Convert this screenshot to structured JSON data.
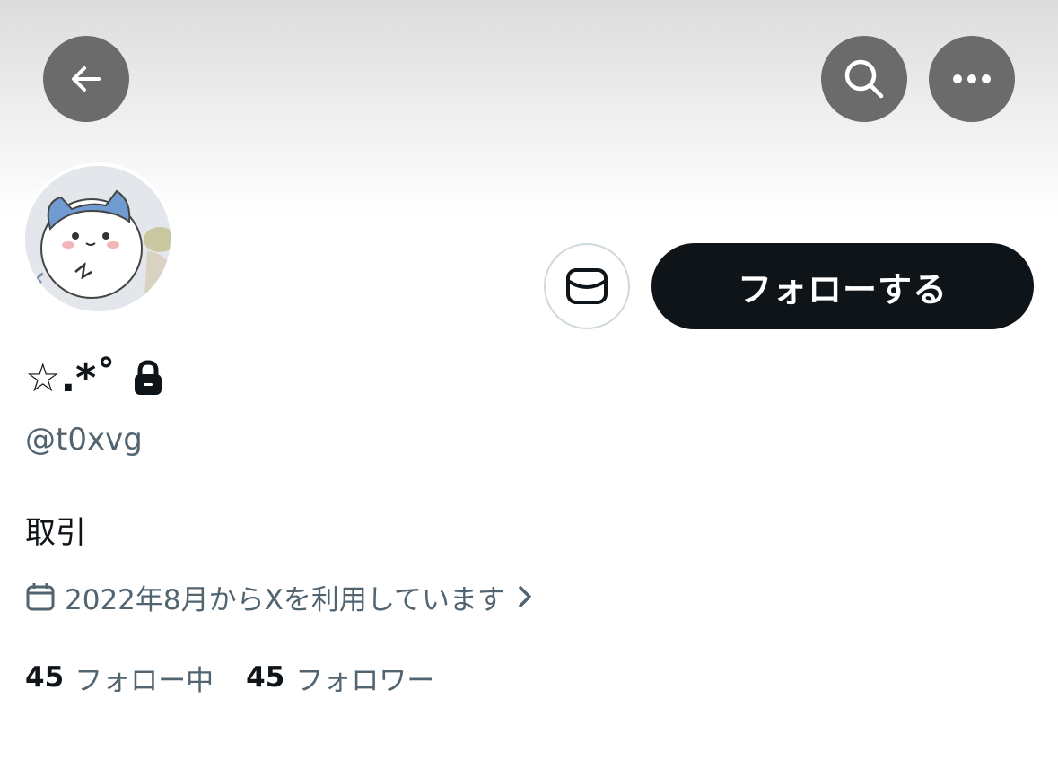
{
  "profile": {
    "display_name": "☆.*˚",
    "handle": "@t0xvg",
    "bio": "取引",
    "joined": "2022年8月からXを利用しています",
    "following_count": "45",
    "following_label": "フォロー中",
    "followers_count": "45",
    "followers_label": "フォロワー"
  },
  "actions": {
    "follow_label": "フォローする"
  },
  "icons": {
    "back": "back-arrow-icon",
    "search": "search-icon",
    "more": "more-icon",
    "message": "message-icon",
    "lock": "lock-icon",
    "calendar": "calendar-icon",
    "chevron": "chevron-right-icon"
  },
  "colors": {
    "primary_text": "#0f1419",
    "secondary_text": "#536471",
    "follow_button_bg": "#0f1419",
    "header_button_bg": "#6b6b6b"
  }
}
